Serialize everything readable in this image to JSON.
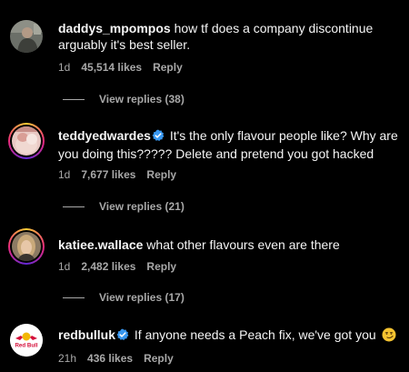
{
  "comments": [
    {
      "username": "daddys_mpompos",
      "verified": false,
      "text": "how tf does a company discontinue arguably it's best seller.",
      "time": "1d",
      "likes": "45,514 likes",
      "reply_label": "Reply",
      "view_replies": "View replies (38)"
    },
    {
      "username": "teddyedwardes",
      "verified": true,
      "text": "It's the only flavour people like? Why are you doing this????? Delete and pretend you got hacked",
      "time": "1d",
      "likes": "7,677 likes",
      "reply_label": "Reply",
      "view_replies": "View replies (21)"
    },
    {
      "username": "katiee.wallace",
      "verified": false,
      "text": "what other flavours even are there",
      "time": "1d",
      "likes": "2,482 likes",
      "reply_label": "Reply",
      "view_replies": "View replies (17)"
    },
    {
      "username": "redbulluk",
      "verified": true,
      "text": "If anyone needs a Peach fix, we've got you",
      "time": "21h",
      "likes": "436 likes",
      "reply_label": "Reply",
      "avatar_logo_text": "Red Bull",
      "emoji": "smirking-face-icon"
    }
  ],
  "colors": {
    "background": "#000000",
    "text": "#f5f5f5",
    "secondary": "#a8a8a8",
    "verified": "#3897f0"
  }
}
